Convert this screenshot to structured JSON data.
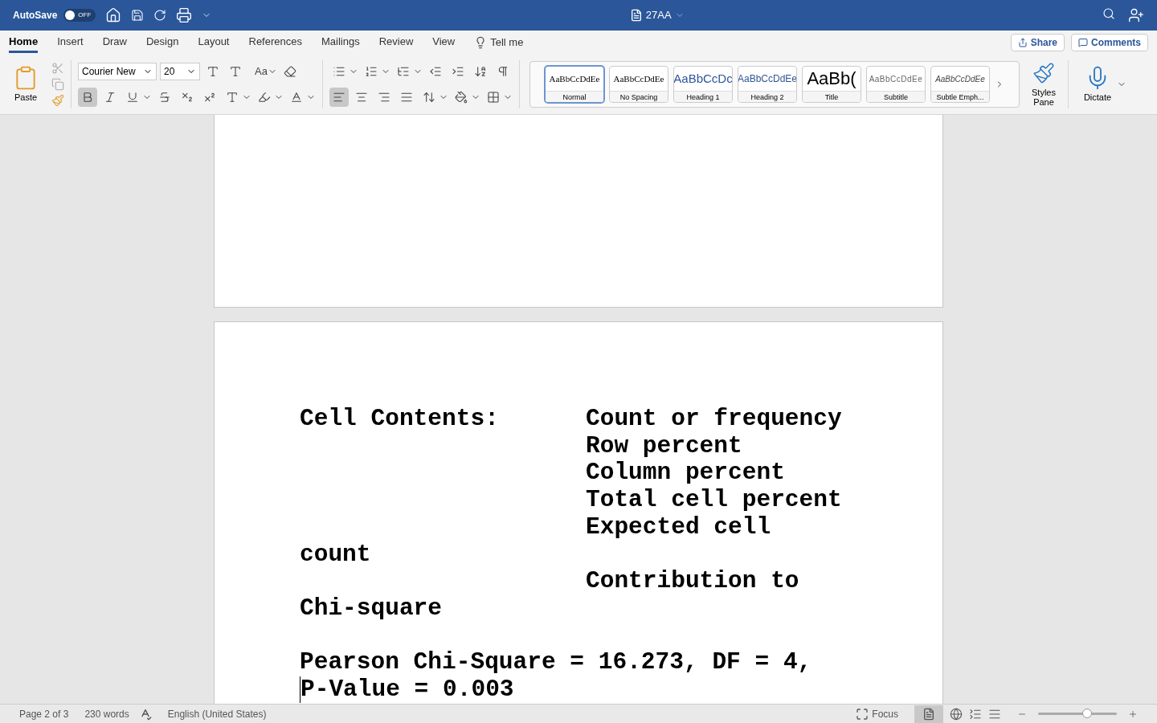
{
  "titlebar": {
    "autosave_label": "AutoSave",
    "autosave_on": false,
    "autosave_state": "OFF",
    "doc_title": "27AA"
  },
  "tabs": [
    {
      "label": "Home",
      "selected": true
    },
    {
      "label": "Insert",
      "selected": false
    },
    {
      "label": "Draw",
      "selected": false
    },
    {
      "label": "Design",
      "selected": false
    },
    {
      "label": "Layout",
      "selected": false
    },
    {
      "label": "References",
      "selected": false
    },
    {
      "label": "Mailings",
      "selected": false
    },
    {
      "label": "Review",
      "selected": false
    },
    {
      "label": "View",
      "selected": false
    }
  ],
  "tell_me": "Tell me",
  "share": "Share",
  "comments": "Comments",
  "ribbon": {
    "paste": "Paste",
    "font": "Courier New",
    "size": "20",
    "bold_on": true,
    "align_left_on": true,
    "change_case": "Aa"
  },
  "styles": [
    {
      "preview": "AaBbCcDdEe",
      "label": "Normal",
      "kind": "normal",
      "selected": true
    },
    {
      "preview": "AaBbCcDdEe",
      "label": "No Spacing",
      "kind": "normal",
      "selected": false
    },
    {
      "preview": "AaBbCcDc",
      "label": "Heading 1",
      "kind": "heading1",
      "selected": false
    },
    {
      "preview": "AaBbCcDdEe",
      "label": "Heading 2",
      "kind": "heading2",
      "selected": false
    },
    {
      "preview": "AaBb(",
      "label": "Title",
      "kind": "title",
      "selected": false
    },
    {
      "preview": "AaBbCcDdEe",
      "label": "Subtitle",
      "kind": "subtitle",
      "selected": false
    },
    {
      "preview": "AaBbCcDdEe",
      "label": "Subtle Emph...",
      "kind": "emphasis",
      "selected": false
    }
  ],
  "styles_pane": "Styles Pane",
  "dictate": "Dictate",
  "document": [
    {
      "col1": "Cell Contents:",
      "col2": "Count or frequency"
    },
    {
      "col2": "Row percent"
    },
    {
      "col2": "Column percent"
    },
    {
      "col2": "Total cell percent"
    },
    {
      "col2": "Expected cell"
    },
    {
      "col1": "count"
    },
    {
      "col2": "Contribution to"
    },
    {
      "col1": "Chi-square"
    },
    {
      "col1": "Pearson Chi-Square = 16.273, DF = 4,",
      "gap_before": true
    },
    {
      "col1": "P-Value = 0.003",
      "cursor": true
    }
  ],
  "status": {
    "page": "Page 2 of 3",
    "words": "230 words",
    "language": "English (United States)",
    "focus": "Focus",
    "zoom": {
      "level": 0.62
    }
  }
}
